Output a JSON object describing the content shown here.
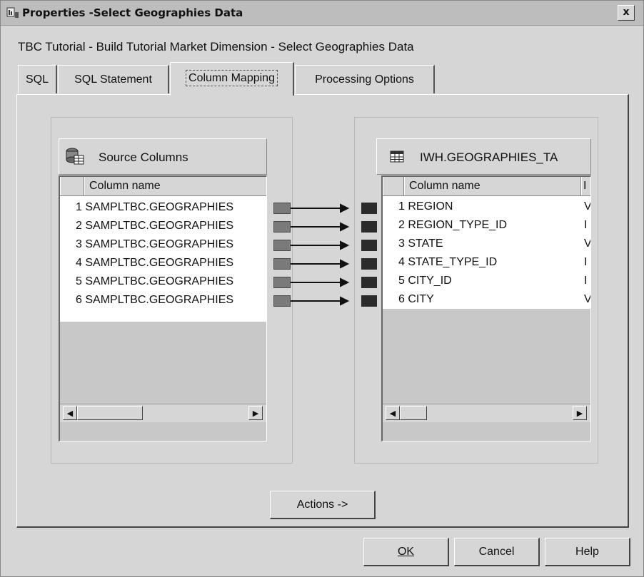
{
  "window": {
    "title": "Properties -Select Geographies Data",
    "close_label": "x",
    "subtitle": "TBC Tutorial - Build Tutorial Market Dimension - Select Geographies Data"
  },
  "tabs": [
    {
      "label": "SQL"
    },
    {
      "label": "SQL Statement"
    },
    {
      "label": "Column Mapping",
      "active": true
    },
    {
      "label": "Processing Options"
    }
  ],
  "source": {
    "title": "Source Columns",
    "icon": "database-table-icon",
    "column_header": "Column name",
    "rows": [
      "1 SAMPLTBC.GEOGRAPHIES",
      "2 SAMPLTBC.GEOGRAPHIES",
      "3 SAMPLTBC.GEOGRAPHIES",
      "4 SAMPLTBC.GEOGRAPHIES",
      "5 SAMPLTBC.GEOGRAPHIES",
      "6 SAMPLTBC.GEOGRAPHIES"
    ]
  },
  "target": {
    "title": "IWH.GEOGRAPHIES_TA",
    "icon": "table-grid-icon",
    "column_header": "Column name",
    "second_header": "I",
    "rows": [
      {
        "name": "1 REGION",
        "type": "V"
      },
      {
        "name": "2 REGION_TYPE_ID",
        "type": "I"
      },
      {
        "name": "3 STATE",
        "type": "V"
      },
      {
        "name": "4 STATE_TYPE_ID",
        "type": "I"
      },
      {
        "name": "5 CITY_ID",
        "type": "I"
      },
      {
        "name": "6 CITY",
        "type": "V"
      }
    ]
  },
  "actions_label": "Actions ->",
  "footer": {
    "ok": "OK",
    "cancel": "Cancel",
    "help": "Help"
  }
}
